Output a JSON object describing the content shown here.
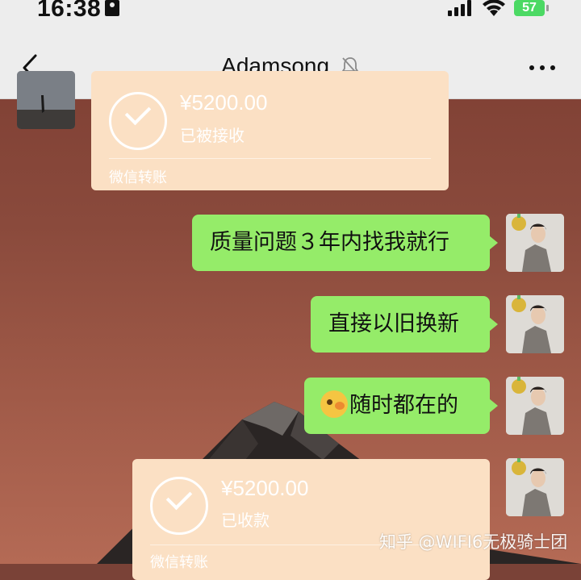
{
  "status_bar": {
    "time": "16:38",
    "battery": "57"
  },
  "nav": {
    "title": "Adamsong."
  },
  "messages": {
    "top_transfer": {
      "amount": "¥5200.00",
      "status": "已被接收",
      "footer": "微信转账"
    },
    "bubble_1": "质量问题３年内找我就行",
    "bubble_2": "直接以旧换新",
    "bubble_3": "随时都在的",
    "bottom_transfer": {
      "amount": "¥5200.00",
      "status": "已收款",
      "footer": "微信转账"
    }
  },
  "watermark": "知乎 @WIFI6无极骑士团",
  "colors": {
    "bubble_green": "#95ec69",
    "transfer_orange": "#fbe0c4",
    "nav_bg": "#ededed",
    "battery_green": "#4cd964"
  }
}
